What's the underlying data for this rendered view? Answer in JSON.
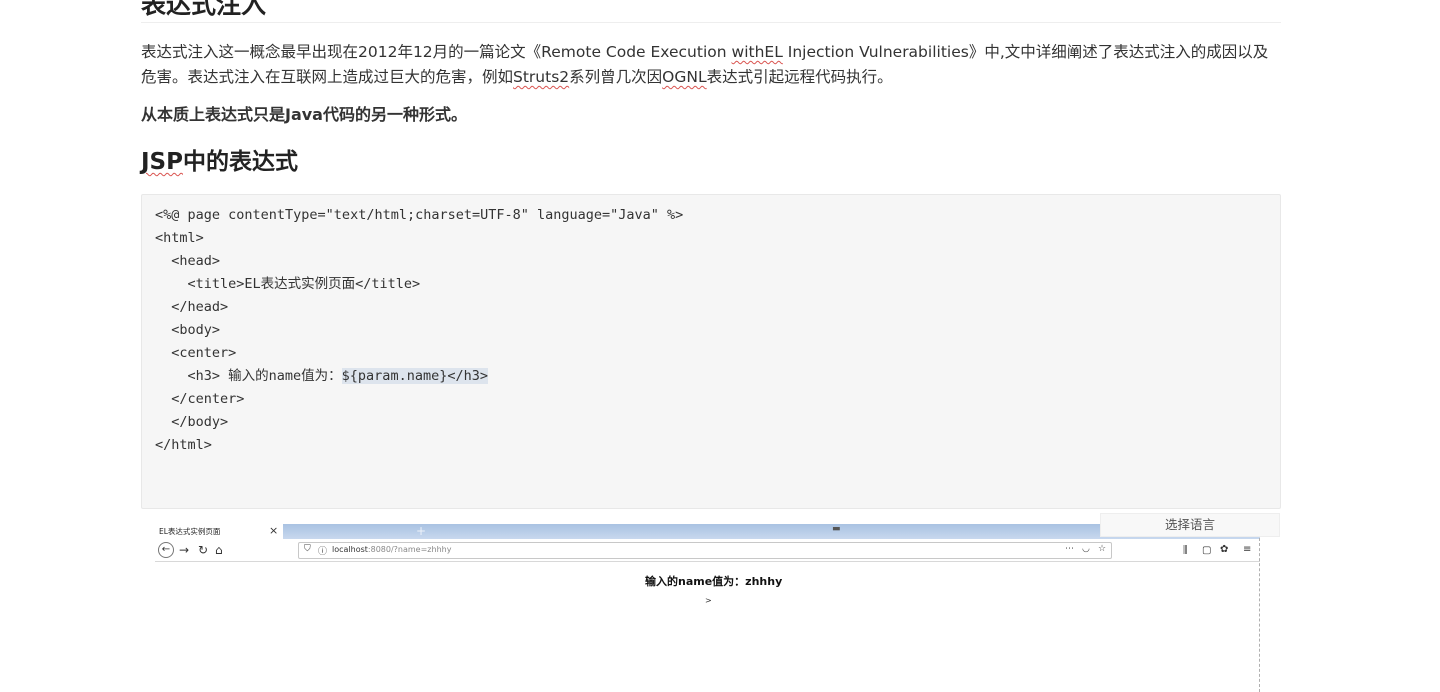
{
  "article": {
    "section_heading": "表达式注入",
    "para": {
      "part1": "表达式注入这一概念最早出现在2012年12月的一篇论文《Remote Code Execution ",
      "with_el": "withEL",
      "part2": " Injection Vulnerabilities》中,文中详细阐述了表达式注入的成因以及危害。表达式注入在互联网上造成过巨大的危害，例如",
      "struts2": "Struts2",
      "part3": "系列曾几次因",
      "ognl": "OGNL",
      "part4": "表达式引起远程代码执行。"
    },
    "bold_statement": "从本质上表达式只是Java代码的另一种形式。",
    "jsp_heading": {
      "jsp": "JSP",
      "rest": "中的表达式"
    },
    "code": {
      "lines": [
        "<%@ page contentType=\"text/html;charset=UTF-8\" language=\"Java\" %>",
        "<html>",
        "  <head>",
        "    <title>EL表达式实例页面</title>",
        "  </head>",
        "  <body>",
        "  <center>",
        "    <h3> 输入的name值为：",
        "  </center>",
        "  </body>",
        "</html>"
      ],
      "highlight": "${param.name}</h3>"
    }
  },
  "screenshot": {
    "tab_title": "EL表达式实例页面",
    "tab_close": "×",
    "new_tab": "+",
    "url_host": "localhost",
    "url_rest": ":8080/?name=zhhhy",
    "heading": "输入的name值为：zhhhy",
    "gt": ">"
  },
  "language_selector": "选择语言"
}
